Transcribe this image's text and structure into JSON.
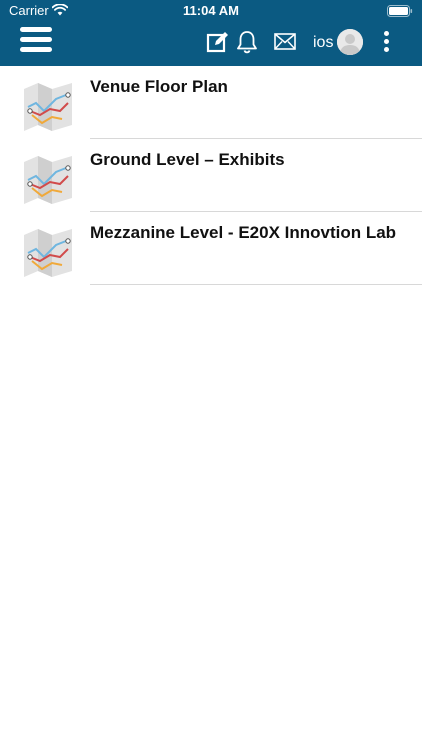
{
  "status_bar": {
    "carrier": "Carrier",
    "time": "11:04 AM"
  },
  "navbar": {
    "user_name": "ios",
    "background_color": "#0b5a82",
    "icons": [
      "menu-icon",
      "edit-icon",
      "bell-icon",
      "mail-icon",
      "avatar-icon",
      "more-vertical-icon"
    ]
  },
  "floor_plans": [
    {
      "title": "Venue Floor Plan"
    },
    {
      "title": "Ground Level – Exhibits"
    },
    {
      "title": "Mezzanine Level - E20X Innovtion Lab"
    }
  ]
}
